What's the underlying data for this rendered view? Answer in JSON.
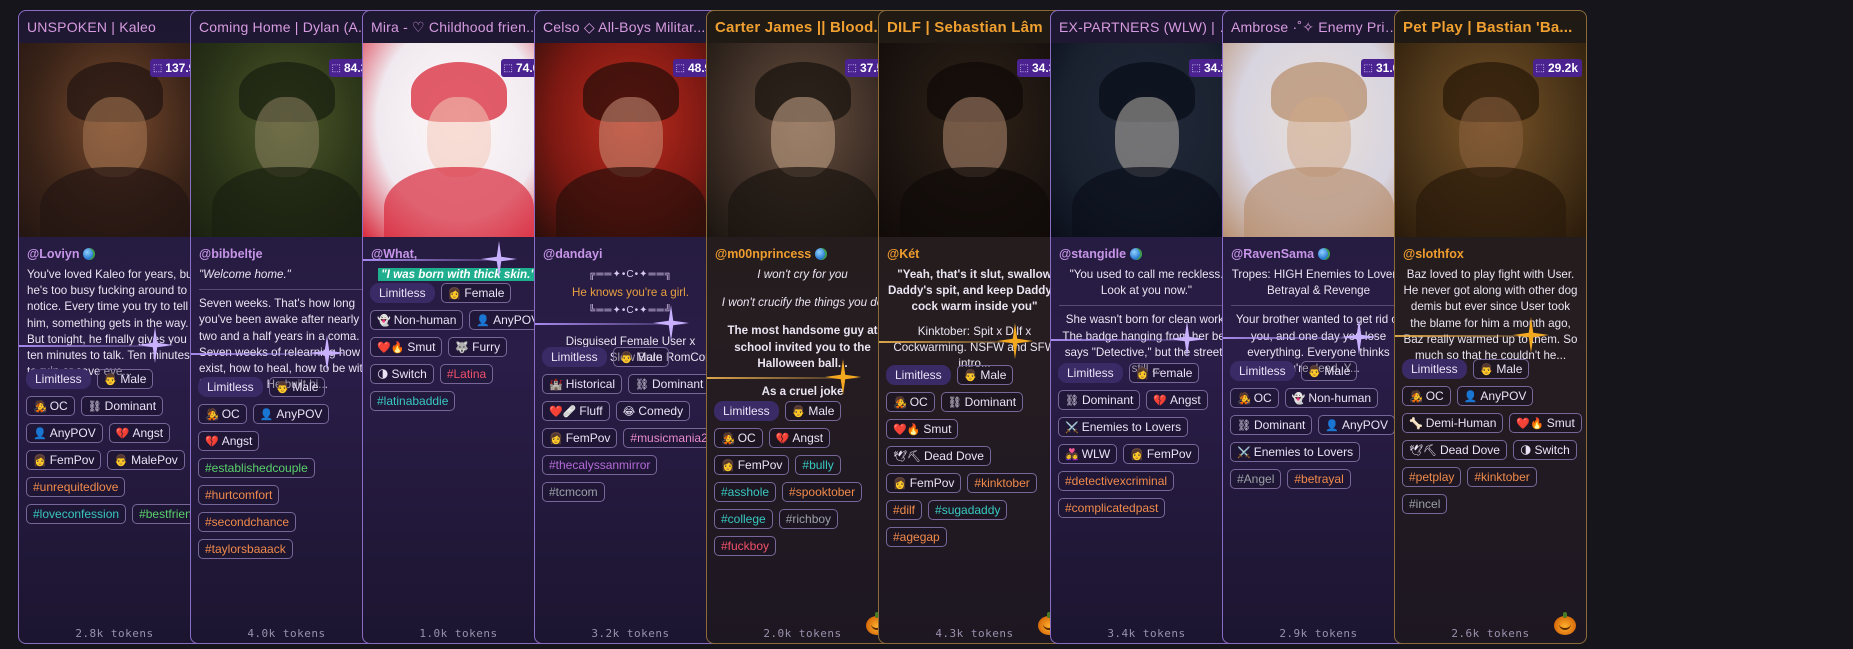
{
  "accent": "#8a6cc4",
  "cards": [
    {
      "title": "UNSPOKEN | Kaleo",
      "style": "purple",
      "count": "137.9k",
      "author": "@Loviyn",
      "verified": true,
      "desc": [
        "You've loved Kaleo for years, but he's too busy fucking around to notice. Every time you try to tell him, something gets in the way. But tonight, he finally gives you ten minutes to talk. Ten minutes to ruin or save eve..."
      ],
      "tags": [
        [
          "Limitless",
          "",
          "lim"
        ],
        [
          "Male",
          "👨",
          "t"
        ],
        [
          "OC",
          "🧑‍🎤",
          "t"
        ],
        [
          "Dominant",
          "⛓",
          "t"
        ],
        [
          "AnyPOV",
          "👤",
          "t"
        ],
        [
          "Angst",
          "💔",
          "t"
        ],
        [
          "FemPov",
          "👩",
          "t"
        ],
        [
          "MalePov",
          "👨",
          "t"
        ],
        [
          "#unrequitedlove",
          "",
          "h1"
        ],
        [
          "#loveconfession",
          "",
          "h2"
        ],
        [
          "#bestfriend",
          "",
          "h3"
        ]
      ],
      "tokens": "2.8k tokens"
    },
    {
      "title": "Coming Home | Dylan (A...",
      "style": "purple",
      "count": "84.3k",
      "author": "@bibbeltje",
      "verified": false,
      "desc": [
        "\"Welcome home.\"",
        "Seven weeks. That's how long you've been awake after nearly two and a half years in a coma. Seven weeks of relearning how to exist, how to heal, how to be with Dylan again. He built hi..."
      ],
      "tags": [
        [
          "Limitless",
          "",
          "lim"
        ],
        [
          "Male",
          "👨",
          "t"
        ],
        [
          "OC",
          "🧑‍🎤",
          "t"
        ],
        [
          "AnyPOV",
          "👤",
          "t"
        ],
        [
          "Angst",
          "💔",
          "t"
        ],
        [
          "#establishedcouple",
          "",
          "h3"
        ],
        [
          "#hurtcomfort",
          "",
          "h1"
        ],
        [
          "#secondchance",
          "",
          "h1"
        ],
        [
          "#taylorsbaaack",
          "",
          "h1"
        ]
      ],
      "tokens": "4.0k tokens"
    },
    {
      "title": "Mira - ♡ Childhood frien...",
      "style": "purple",
      "count": "74.0k",
      "author": "@What,",
      "verified": false,
      "desc": [
        "\"I was born with thick skin.\""
      ],
      "tags": [
        [
          "Limitless",
          "",
          "lim"
        ],
        [
          "Female",
          "👩",
          "t"
        ],
        [
          "Non-human",
          "👻",
          "t"
        ],
        [
          "AnyPOV",
          "👤",
          "t"
        ],
        [
          "Smut",
          "❤️🔥",
          "t"
        ],
        [
          "Furry",
          "🐺",
          "t"
        ],
        [
          "Switch",
          "🌗",
          "t"
        ],
        [
          "#Latina",
          "",
          "h4"
        ],
        [
          "#latinabaddie",
          "",
          "h2"
        ]
      ],
      "tokens": "1.0k tokens"
    },
    {
      "title": "Celso ◇ All-Boys Militar...",
      "style": "purple",
      "count": "48.9k",
      "author": "@dandayi",
      "verified": false,
      "desc": [
        "╔══✦•C•✦══╗",
        "He knows you're a girl.",
        "╚══✦•C•✦══╝",
        "Disguised Female User x Instructor ◇ Slow Burn RomCom"
      ],
      "tags": [
        [
          "Limitless",
          "",
          "lim"
        ],
        [
          "Male",
          "👨",
          "t"
        ],
        [
          "Historical",
          "🏰",
          "t"
        ],
        [
          "Dominant",
          "⛓",
          "t"
        ],
        [
          "Fluff",
          "❤️🩹",
          "t"
        ],
        [
          "Comedy",
          "😂",
          "t"
        ],
        [
          "FemPov",
          "👩",
          "t"
        ],
        [
          "#musicmania2",
          "",
          "h5"
        ],
        [
          "#thecalyssanmirror",
          "",
          "h6"
        ],
        [
          "#tcmcom",
          "",
          "h7"
        ]
      ],
      "tokens": "3.2k tokens"
    },
    {
      "title": "Carter James || Blood...",
      "style": "gold",
      "count": "37.5k",
      "author": "@m00nprincess",
      "verified": true,
      "desc": [
        "I won't cry for you",
        "I won't crucify the things you do",
        "The most handsome guy at school invited you to the Halloween ball...",
        "As a cruel joke"
      ],
      "tags": [
        [
          "Limitless",
          "",
          "lim"
        ],
        [
          "Male",
          "👨",
          "t"
        ],
        [
          "OC",
          "🧑‍🎤",
          "t"
        ],
        [
          "Angst",
          "💔",
          "t"
        ],
        [
          "FemPov",
          "👩",
          "t"
        ],
        [
          "#bully",
          "",
          "h2"
        ],
        [
          "#asshole",
          "",
          "h2"
        ],
        [
          "#spooktober",
          "",
          "h1"
        ],
        [
          "#college",
          "",
          "h2"
        ],
        [
          "#richboy",
          "",
          "h7"
        ],
        [
          "#fuckboy",
          "",
          "h4"
        ]
      ],
      "tokens": "2.0k tokens"
    },
    {
      "title": "DILF | Sebastian Lâm",
      "style": "gold",
      "count": "34.3k",
      "author": "@Két",
      "verified": false,
      "desc": [
        "\"Yeah, that's it slut, swallow Daddy's spit, and keep Daddy's cock warm inside you\"",
        "Kinktober: Spit x Dilf x Cockwarming. NSFW and SFW intro..."
      ],
      "tags": [
        [
          "Limitless",
          "",
          "lim"
        ],
        [
          "Male",
          "👨",
          "t"
        ],
        [
          "OC",
          "🧑‍🎤",
          "t"
        ],
        [
          "Dominant",
          "⛓",
          "t"
        ],
        [
          "Smut",
          "❤️🔥",
          "t"
        ],
        [
          "Dead Dove",
          "🕊⛏",
          "t"
        ],
        [
          "FemPov",
          "👩",
          "t"
        ],
        [
          "#kinktober",
          "",
          "h1"
        ],
        [
          "#dilf",
          "",
          "h1"
        ],
        [
          "#sugadaddy",
          "",
          "h2"
        ],
        [
          "#agegap",
          "",
          "h1"
        ]
      ],
      "tokens": "4.3k tokens"
    },
    {
      "title": "EX-PARTNERS (WLW) | Lin ...",
      "style": "purple",
      "count": "34.2k",
      "author": "@stangidle",
      "verified": true,
      "desc": [
        "\"You used to call me reckless. Look at you now.\"",
        "She wasn't born for clean work. The badge hanging from her belt says \"Detective,\" but the streets still ..."
      ],
      "tags": [
        [
          "Limitless",
          "",
          "lim"
        ],
        [
          "Female",
          "👩",
          "t"
        ],
        [
          "Dominant",
          "⛓",
          "t"
        ],
        [
          "Angst",
          "💔",
          "t"
        ],
        [
          "Enemies to Lovers",
          "⚔️",
          "t"
        ],
        [
          "WLW",
          "👩‍❤️‍👩",
          "t"
        ],
        [
          "FemPov",
          "👩",
          "t"
        ],
        [
          "#detectivexcriminal",
          "",
          "h1"
        ],
        [
          "#complicatedpast",
          "",
          "h1"
        ]
      ],
      "tokens": "3.4k tokens"
    },
    {
      "title": "Ambrose ·˚✧ Enemy Prince",
      "style": "purple",
      "count": "31.0k",
      "author": "@RavenSama",
      "verified": true,
      "desc": [
        "Tropes: HIGH Enemies to Lovers, Betrayal & Revenge",
        "Your brother wanted to get rid of you, and one day you lose everything. Everyone thinks you're dead. Y..."
      ],
      "tags": [
        [
          "Limitless",
          "",
          "lim"
        ],
        [
          "Male",
          "👨",
          "t"
        ],
        [
          "OC",
          "🧑‍🎤",
          "t"
        ],
        [
          "Non-human",
          "👻",
          "t"
        ],
        [
          "Dominant",
          "⛓",
          "t"
        ],
        [
          "AnyPOV",
          "👤",
          "t"
        ],
        [
          "Enemies to Lovers",
          "⚔️",
          "t"
        ],
        [
          "#Angel",
          "",
          "h7"
        ],
        [
          "#betrayal",
          "",
          "h1"
        ]
      ],
      "tokens": "2.9k tokens"
    },
    {
      "title": "Pet Play | Bastian 'Ba...",
      "style": "gold",
      "count": "29.2k",
      "author": "@slothfox",
      "verified": false,
      "desc": [
        "Baz loved to play fight with User. He never got along with other dog demis but ever since User took the blame for him a month ago, Baz really warmed up to them. So much so that he couldn't he..."
      ],
      "tags": [
        [
          "Limitless",
          "",
          "lim"
        ],
        [
          "Male",
          "👨",
          "t"
        ],
        [
          "OC",
          "🧑‍🎤",
          "t"
        ],
        [
          "AnyPOV",
          "👤",
          "t"
        ],
        [
          "Demi-Human",
          "🦴",
          "t"
        ],
        [
          "Smut",
          "❤️🔥",
          "t"
        ],
        [
          "Dead Dove",
          "🕊⛏",
          "t"
        ],
        [
          "Switch",
          "🌗",
          "t"
        ],
        [
          "#petplay",
          "",
          "h1"
        ],
        [
          "#kinktober",
          "",
          "h1"
        ],
        [
          "#incel",
          "",
          "h7"
        ]
      ],
      "tokens": "2.6k tokens"
    }
  ]
}
